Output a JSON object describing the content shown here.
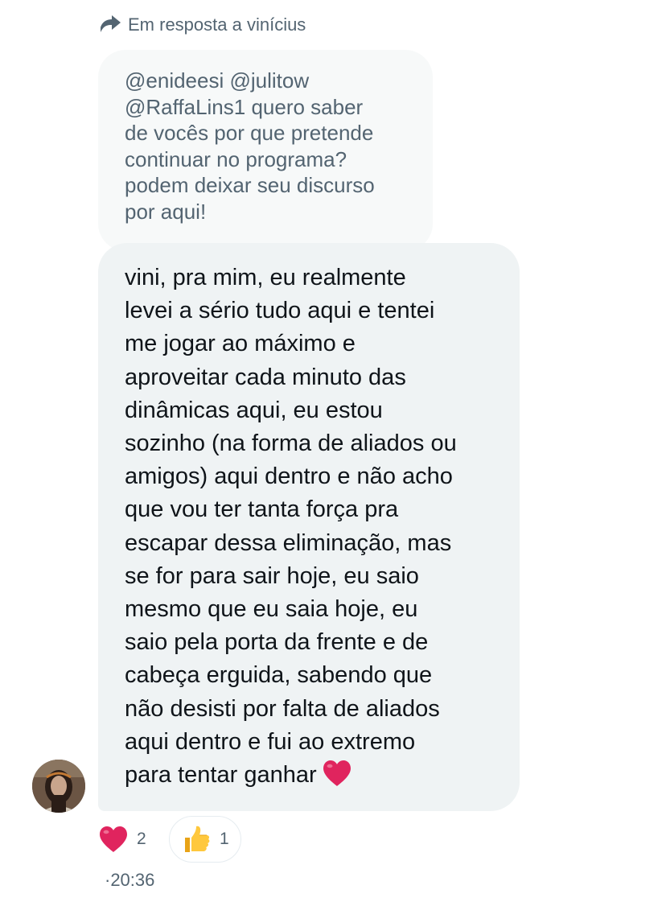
{
  "reply_context": {
    "text": "Em resposta a vinícius",
    "icon": "reply-arrow-icon"
  },
  "quoted_message": {
    "text": "@enideesi @julitow\n@RaffaLins1 quero saber\nde vocês por que pretende\ncontinuar no programa?\npodem deixar seu discurso\npor aqui!"
  },
  "message": {
    "text": "vini, pra mim, eu realmente\nlevei a sério tudo aqui e tentei\nme jogar ao máximo e\naproveitar cada minuto das\ndinâmicas aqui, eu estou\nsozinho (na forma de aliados ou\namigos) aqui dentro e não acho\nque vou ter tanta força pra\nescapar dessa eliminação, mas\nse for para sair hoje, eu saio\nmesmo que eu saia hoje, eu\nsaio pela porta da frente e de\ncabeça erguida, sabendo que\nnão desisti por falta de aliados\naqui dentro e fui ao extremo\npara tentar ganhar",
    "trailing_emoji": "red-heart-icon"
  },
  "reactions": [
    {
      "emoji": "red-heart-icon",
      "count": "2"
    },
    {
      "emoji": "thumbs-up-icon",
      "count": "1"
    }
  ],
  "timestamp": "·20:36",
  "colors": {
    "secondary_text": "#536471",
    "quoted_bg": "#f7f9f9",
    "bubble_bg": "#eff3f4",
    "heart": "#e0245e"
  }
}
